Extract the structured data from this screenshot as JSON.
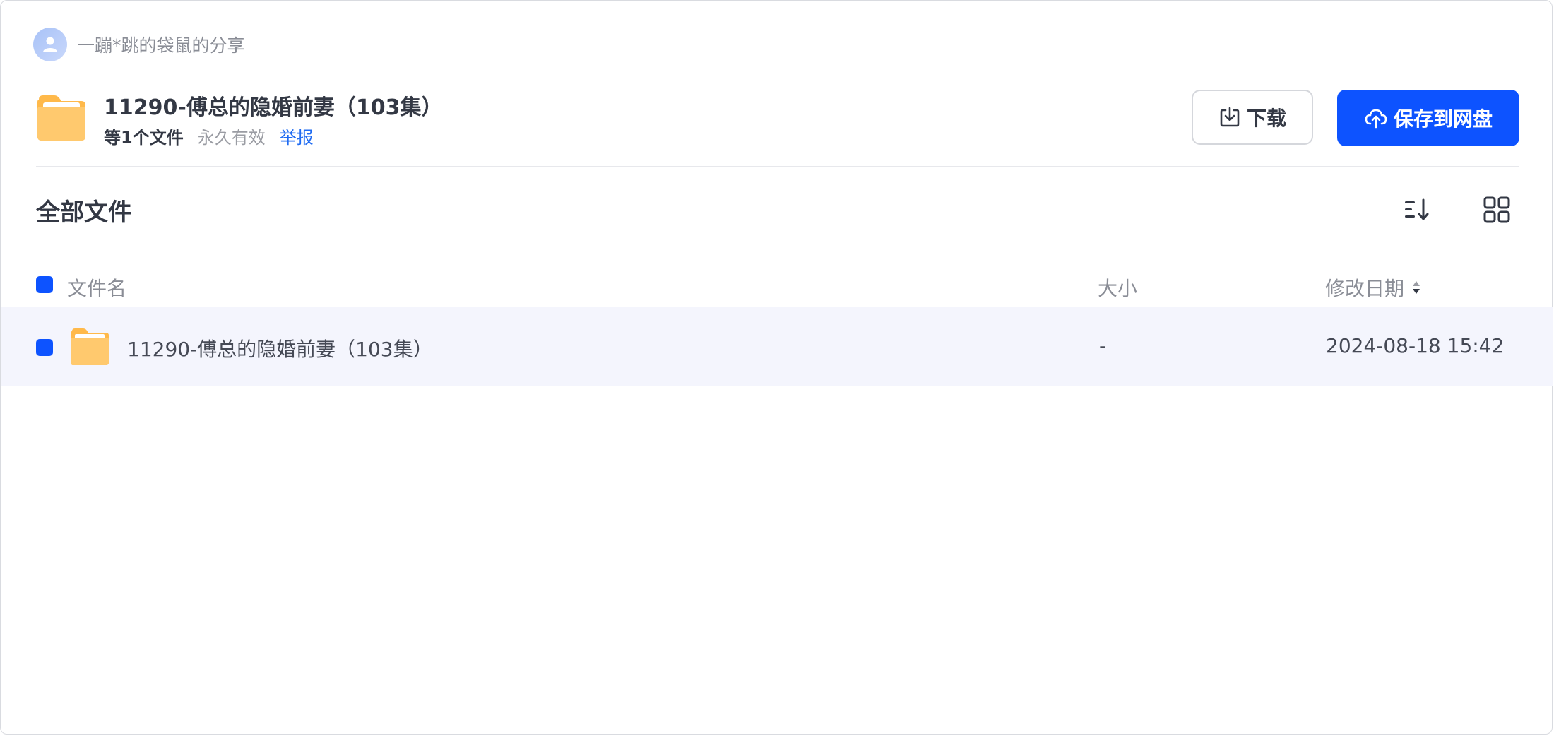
{
  "sharer": {
    "name": "一蹦*跳的袋鼠的分享"
  },
  "share": {
    "title": "11290-傅总的隐婚前妻（103集）",
    "file_count": "等1个文件",
    "validity": "永久有效",
    "report_label": "举报"
  },
  "actions": {
    "download_label": "下载",
    "save_label": "保存到网盘"
  },
  "section": {
    "title": "全部文件"
  },
  "table": {
    "headers": {
      "name": "文件名",
      "size": "大小",
      "modified": "修改日期"
    },
    "rows": [
      {
        "name": "11290-傅总的隐婚前妻（103集）",
        "size": "-",
        "modified": "2024-08-18 15:42",
        "icon": "folder-icon"
      }
    ]
  },
  "colors": {
    "primary": "#0d53ff",
    "link": "#1f6bf2",
    "row_highlight": "#f4f5fd",
    "folder": "#ffc46b"
  }
}
